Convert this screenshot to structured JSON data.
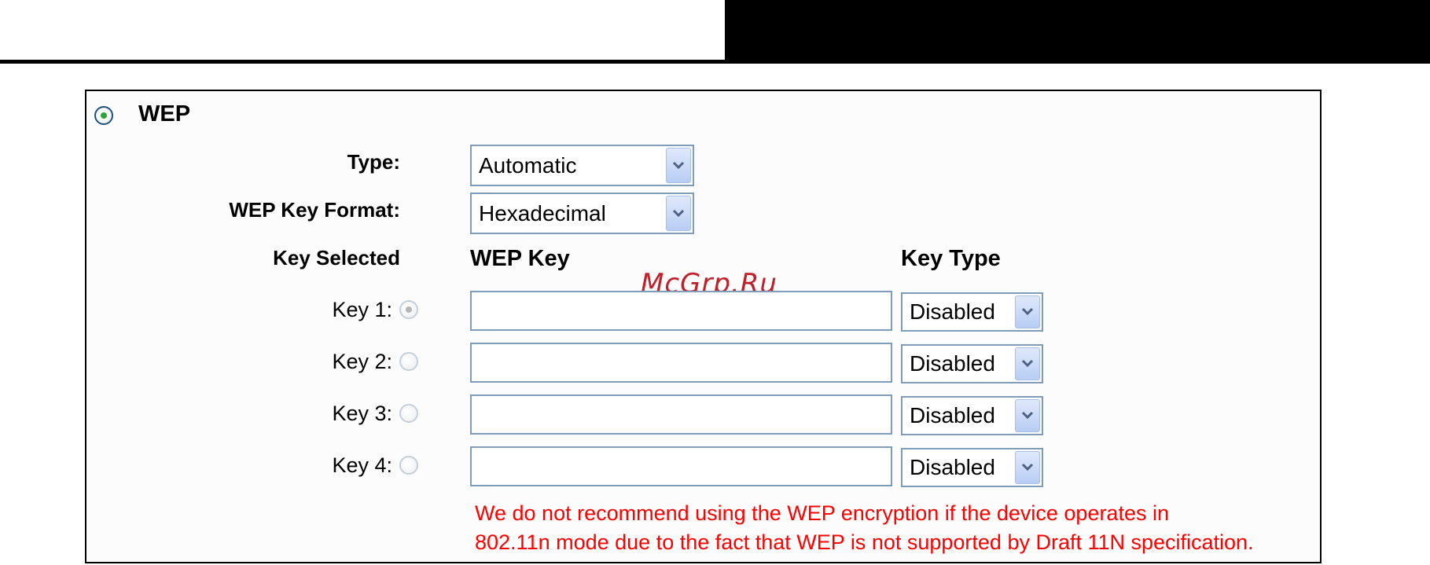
{
  "section": {
    "title": "WEP",
    "selected": true
  },
  "type": {
    "label": "Type:",
    "value": "Automatic"
  },
  "key_format": {
    "label": "WEP Key Format:",
    "value": "Hexadecimal"
  },
  "headers": {
    "key_selected": "Key Selected",
    "wep_key": "WEP Key",
    "key_type": "Key Type"
  },
  "keys": [
    {
      "label": "Key 1:",
      "selected": true,
      "value": "",
      "type": "Disabled"
    },
    {
      "label": "Key 2:",
      "selected": false,
      "value": "",
      "type": "Disabled"
    },
    {
      "label": "Key 3:",
      "selected": false,
      "value": "",
      "type": "Disabled"
    },
    {
      "label": "Key 4:",
      "selected": false,
      "value": "",
      "type": "Disabled"
    }
  ],
  "warning": {
    "line1": "We do not recommend using the WEP encryption if the device operates in",
    "line2": "802.11n mode due to the fact that WEP is not supported by Draft 11N specification."
  },
  "watermark": "McGrp.Ru",
  "colors": {
    "warning": "#ff0000",
    "select_border": "#7f9db9",
    "radio_checked": "#2fa23a"
  }
}
